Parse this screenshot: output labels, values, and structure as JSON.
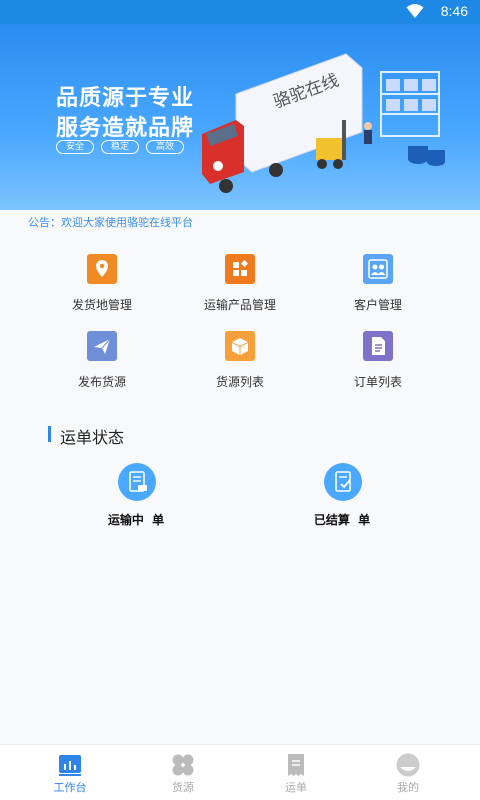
{
  "status_bar": {
    "time": "8:46"
  },
  "banner": {
    "slogan_line1": "品质源于专业",
    "slogan_line2": "服务造就品牌",
    "tags": [
      "安全",
      "稳定",
      "高效"
    ],
    "truck_text": "骆驼在线"
  },
  "notice": {
    "text": "公告：欢迎大家使用骆驼在线平台"
  },
  "grid": [
    {
      "label": "发货地管理",
      "color": "#f08a24",
      "icon": "location-pin-icon"
    },
    {
      "label": "运输产品管理",
      "color": "#f07b1e",
      "icon": "product-grid-icon"
    },
    {
      "label": "客户管理",
      "color": "#5aa6f4",
      "icon": "customers-icon"
    },
    {
      "label": "发布货源",
      "color": "#6f8fd8",
      "icon": "paper-plane-icon"
    },
    {
      "label": "货源列表",
      "color": "#f5a03a",
      "icon": "box-icon"
    },
    {
      "label": "订单列表",
      "color": "#7f72c8",
      "icon": "document-icon"
    }
  ],
  "waybill_status": {
    "title": "运单状态",
    "items": [
      {
        "label": "运输中  单",
        "icon": "in-transit-doc-icon"
      },
      {
        "label": "已结算  单",
        "icon": "settled-doc-icon"
      }
    ]
  },
  "tabbar": {
    "tabs": [
      {
        "label": "工作台",
        "icon": "dashboard-icon",
        "active": true
      },
      {
        "label": "货源",
        "icon": "cargo-icon",
        "active": false
      },
      {
        "label": "运单",
        "icon": "waybill-icon",
        "active": false
      },
      {
        "label": "我的",
        "icon": "profile-icon",
        "active": false
      }
    ],
    "active_color": "#2f86e8",
    "inactive_color": "#aaaaaa"
  }
}
